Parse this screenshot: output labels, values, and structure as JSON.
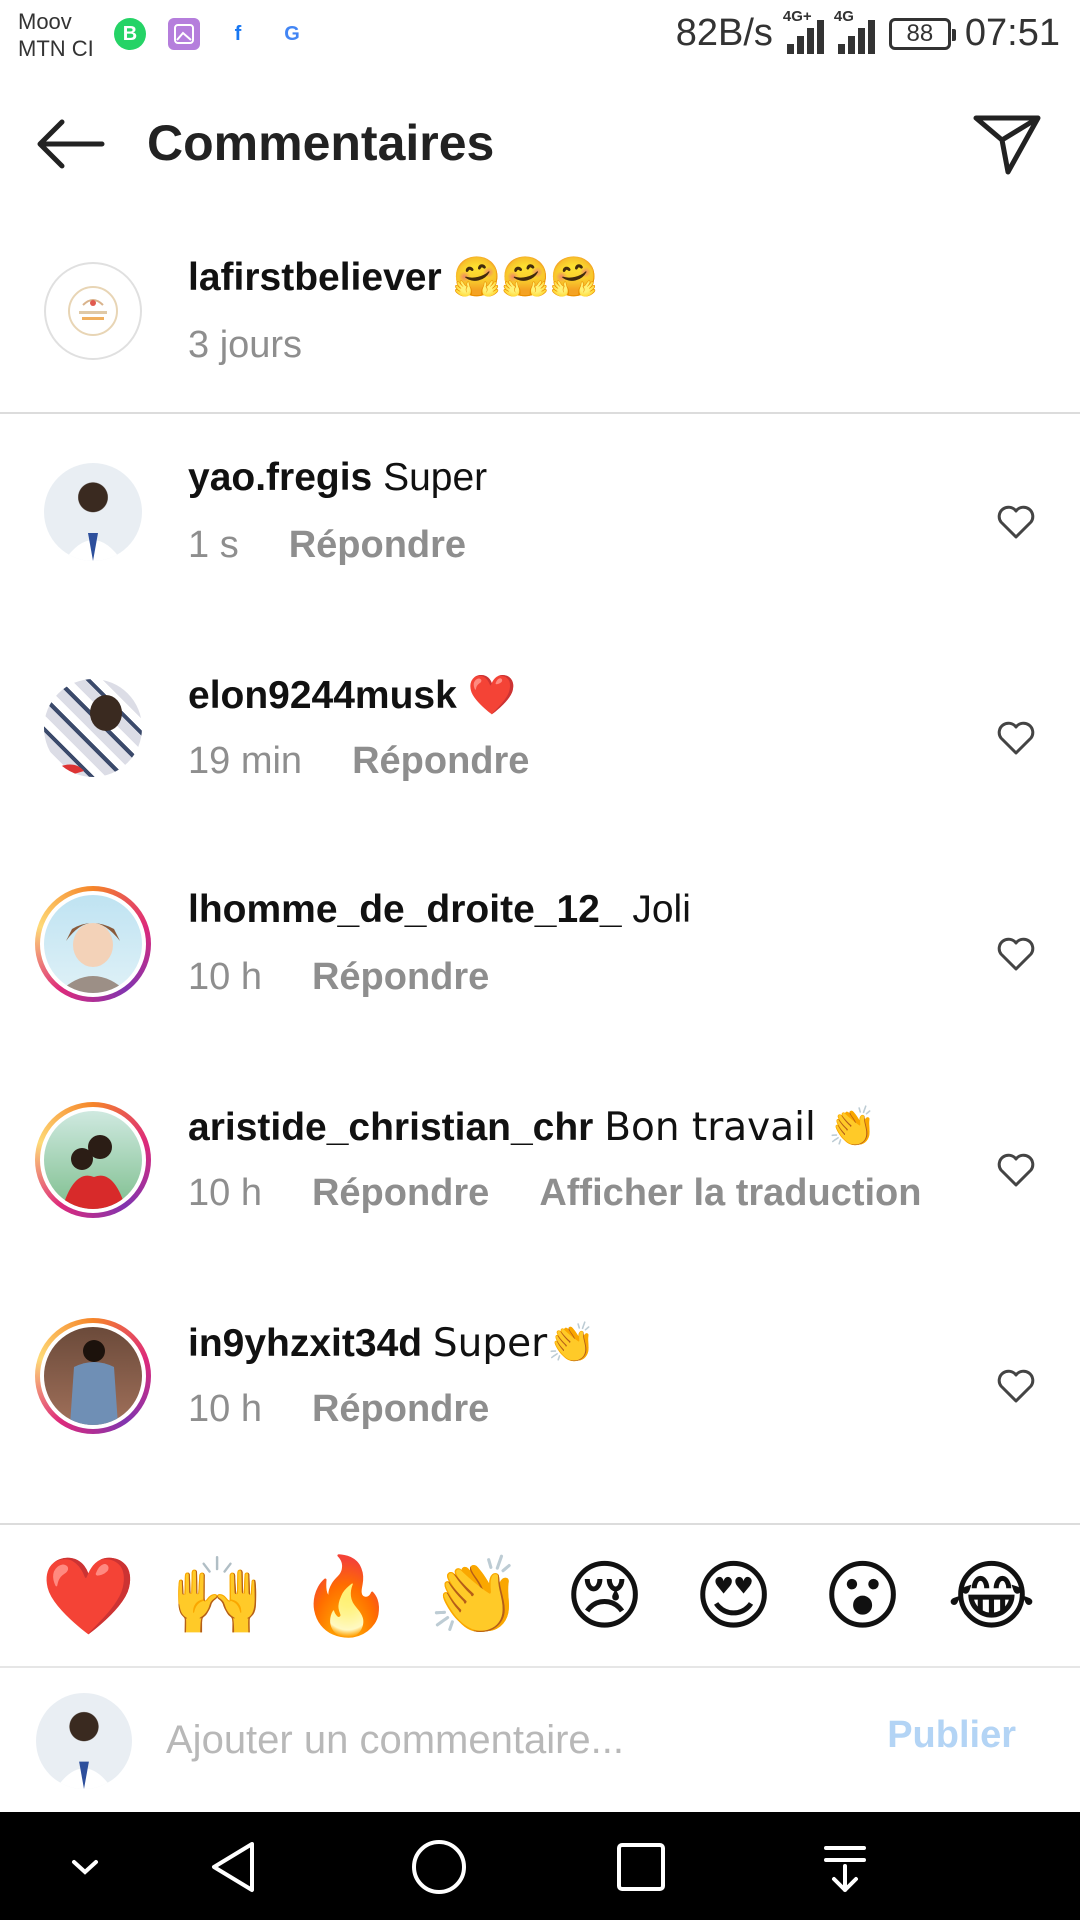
{
  "status_bar": {
    "carrier_line1": "Moov",
    "carrier_line2": "MTN CI",
    "app_icons": [
      "whatsapp-business-icon",
      "gallery-icon",
      "facebook-icon",
      "google-icon"
    ],
    "net_speed": "82B/s",
    "signal1_label": "4G+",
    "signal2_label": "4G",
    "battery": "88",
    "time": "07:51"
  },
  "header": {
    "title": "Commentaires",
    "back_icon": "arrow-left-icon",
    "send_icon": "paper-plane-icon"
  },
  "caption": {
    "username": "lafirstbeliever",
    "text": "🤗🤗🤗",
    "time": "3 jours"
  },
  "reply_label": "Répondre",
  "comments": [
    {
      "username": "yao.fregis",
      "text": "Super",
      "time": "1 s",
      "show_translation": false,
      "has_story_ring": false
    },
    {
      "username": "elon9244musk",
      "text": "❤️",
      "time": "19 min",
      "show_translation": false,
      "has_story_ring": false
    },
    {
      "username": "lhomme_de_droite_12_",
      "text": "Joli",
      "time": "10 h",
      "show_translation": false,
      "has_story_ring": true
    },
    {
      "username": "aristide_christian_chr",
      "text": "Bon travail 👏",
      "time": "10 h",
      "translation_label": "Afficher la traduction",
      "show_translation": true,
      "has_story_ring": true
    },
    {
      "username": "in9yhzxit34d",
      "text": "Super👏",
      "time": "10 h",
      "show_translation": false,
      "has_story_ring": true
    }
  ],
  "emoji_bar": [
    "❤️",
    "🙌",
    "🔥",
    "👏",
    "😢",
    "😍",
    "😮",
    "😂"
  ],
  "composer": {
    "placeholder": "Ajouter un commentaire...",
    "value": "",
    "publish_label": "Publier"
  },
  "colors": {
    "muted_text": "#8e8e8e",
    "publish_disabled": "#b3d4f5",
    "heart_red": "#ed4956",
    "divider": "#dcdcdc"
  }
}
